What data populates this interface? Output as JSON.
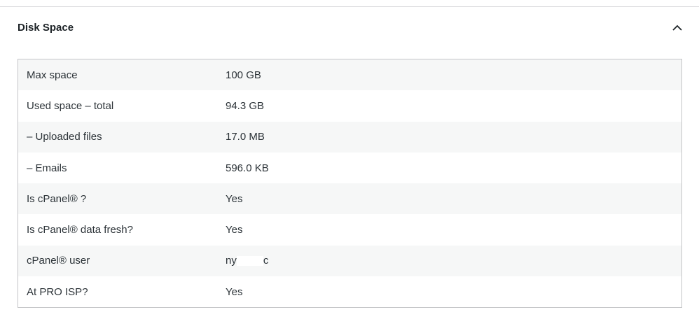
{
  "panel": {
    "title": "Disk Space",
    "toggle_icon": "chevron-up-icon"
  },
  "rows": [
    {
      "label": "Max space",
      "value": "100 GB"
    },
    {
      "label": "Used space – total",
      "value": "94.3 GB"
    },
    {
      "label": "– Uploaded files",
      "value": "17.0 MB"
    },
    {
      "label": "– Emails",
      "value": "596.0 KB"
    },
    {
      "label": "Is cPanel® ?",
      "value": "Yes"
    },
    {
      "label": "Is cPanel® data fresh?",
      "value": "Yes"
    },
    {
      "label": "cPanel® user",
      "value_start": "ny",
      "value_end": "c"
    },
    {
      "label": "At PRO ISP?",
      "value": "Yes"
    }
  ]
}
